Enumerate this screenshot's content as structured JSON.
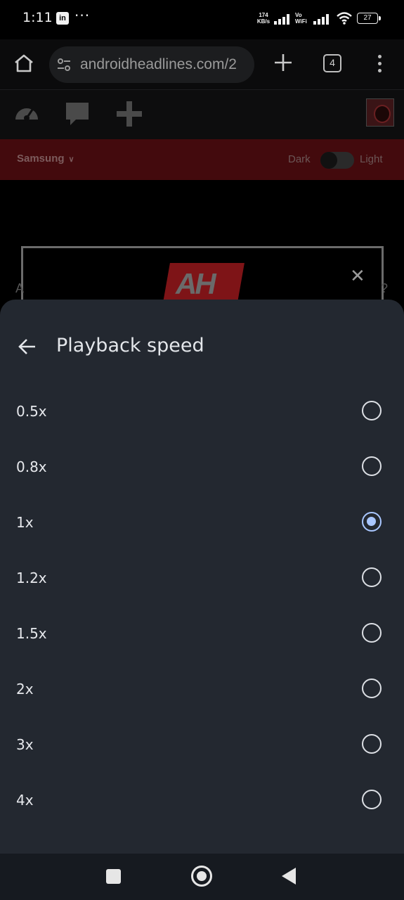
{
  "status_bar": {
    "time": "1:11",
    "app_icon_text": "in",
    "more_dots": "···",
    "net_speed_value": "174",
    "net_speed_unit": "KB/s",
    "vowifi_top": "Vo",
    "vowifi_bottom": "WiFi",
    "battery_level": "27"
  },
  "browser": {
    "url": "androidheadlines.com/2",
    "tab_count": "4"
  },
  "site": {
    "brand_menu": "Samsung",
    "theme_dark_label": "Dark",
    "theme_light_label": "Light",
    "ad_logo": "AH",
    "ad_close": "✕",
    "side_text_left": "A",
    "side_text_right": "?"
  },
  "sheet": {
    "title": "Playback speed",
    "options": [
      {
        "label": "0.5x",
        "selected": false
      },
      {
        "label": "0.8x",
        "selected": false
      },
      {
        "label": "1x",
        "selected": true
      },
      {
        "label": "1.2x",
        "selected": false
      },
      {
        "label": "1.5x",
        "selected": false
      },
      {
        "label": "2x",
        "selected": false
      },
      {
        "label": "3x",
        "selected": false
      },
      {
        "label": "4x",
        "selected": false
      }
    ]
  },
  "colors": {
    "sheet_background": "#232830",
    "selected_accent": "#a9c7ff"
  }
}
